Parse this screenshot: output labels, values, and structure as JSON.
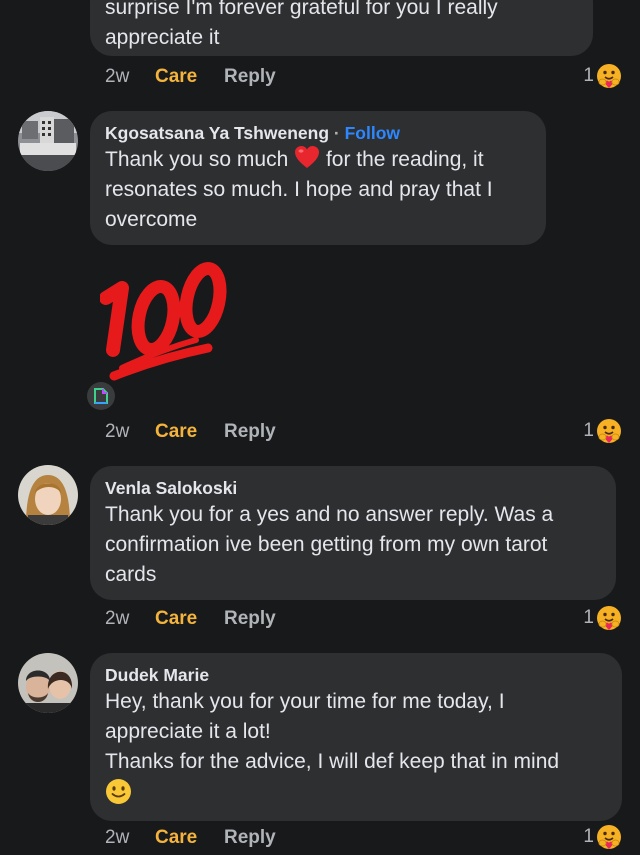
{
  "comments": [
    {
      "text": "surprise I'm forever grateful for you I really\nappreciate it",
      "time": "2w",
      "care": "Care",
      "reply": "Reply",
      "reactions": "1",
      "reaction_icon": "care-hug-emoji"
    },
    {
      "author": "Kgosatsana Ya Tshweneng",
      "separator": "·",
      "follow": "Follow",
      "text_before_emoji": "Thank you so much",
      "text_emoji_icon": "red-heart",
      "text_after_emoji": " for the reading, it\nresonates so much. I hope and pray that I\novercome",
      "sticker": "100",
      "time": "2w",
      "care": "Care",
      "reply": "Reply",
      "reactions": "1",
      "reaction_icon": "care-hug-emoji"
    },
    {
      "author": "Venla Salokoski",
      "text": "Thank you for a yes and no answer reply. Was a\nconfirmation ive been getting from my own tarot\ncards",
      "time": "2w",
      "care": "Care",
      "reply": "Reply",
      "reactions": "1",
      "reaction_icon": "care-hug-emoji"
    },
    {
      "author": "Dudek Marie",
      "text": "Hey, thank you for your time for me today, I\nappreciate it a lot!\nThanks for the advice, I will def keep that in mind",
      "text_emoji_icon": "slightly-smiling-face",
      "time": "2w",
      "care": "Care",
      "reply": "Reply",
      "reactions": "1",
      "reaction_icon": "care-hug-emoji"
    }
  ],
  "colors": {
    "background": "#18191a",
    "bubble": "#2e2f31",
    "follow": "#2d88ff",
    "care": "#f3b33d",
    "secondary_text": "#b0b3b8"
  }
}
